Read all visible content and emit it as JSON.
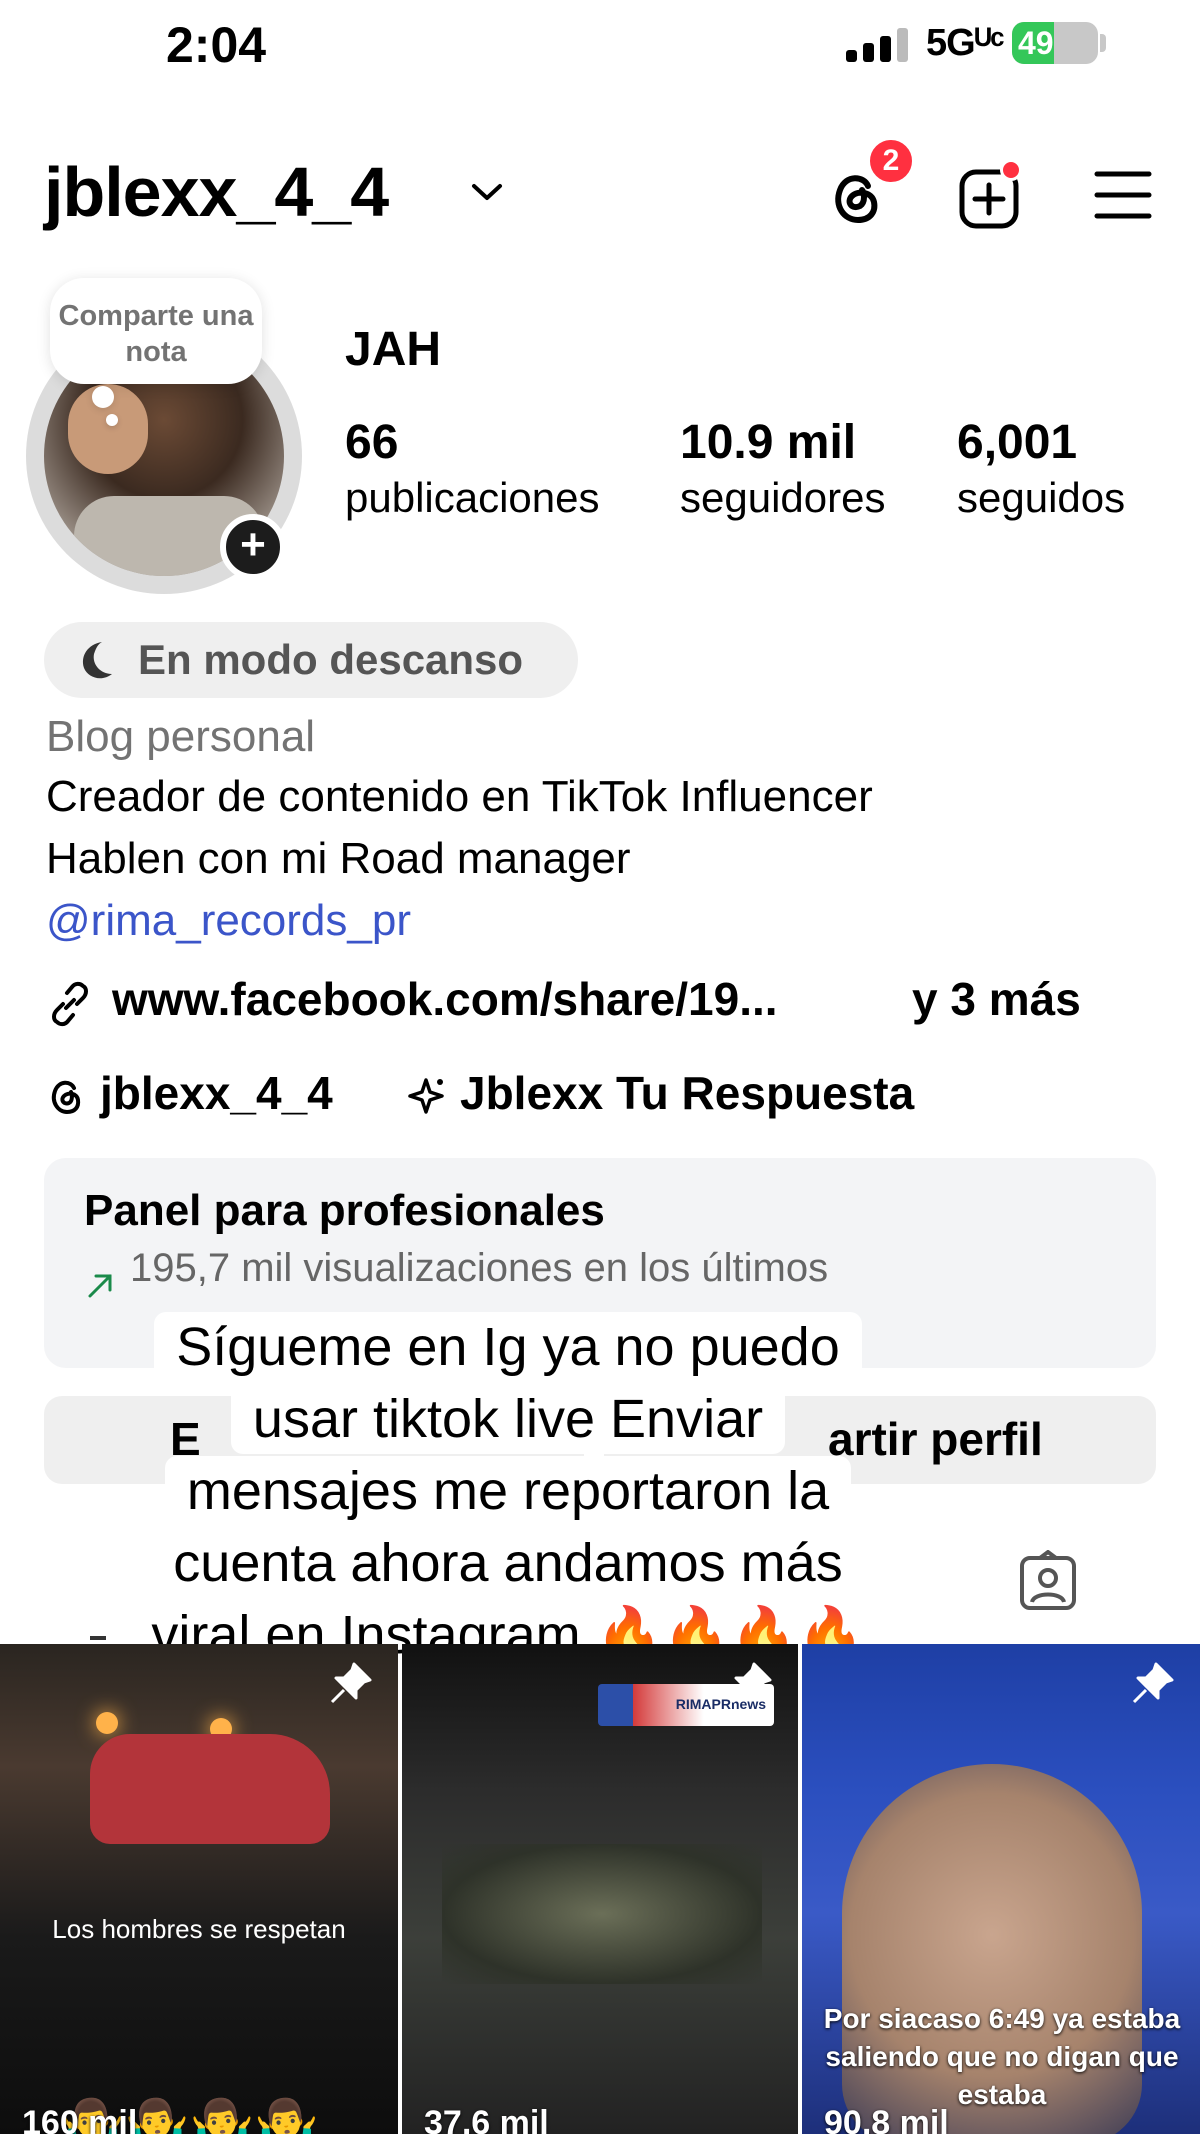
{
  "status_bar": {
    "time": "2:04",
    "network": "5Gᵁᶜ",
    "battery": "49",
    "battery_level_percent": 49,
    "battery_color": "#34c759"
  },
  "header": {
    "username": "jblexx_4_4",
    "threads_badge": "2",
    "icons": [
      "threads-icon",
      "create-icon",
      "menu-icon"
    ],
    "badge_color": "#ff3040"
  },
  "profile": {
    "note_bubble": "Comparte una nota",
    "display_name": "JAH",
    "stats": [
      {
        "value": "66",
        "label": "publicaciones"
      },
      {
        "value": "10.9 mil",
        "label": "seguidores"
      },
      {
        "value": "6,001",
        "label": "seguidos"
      }
    ]
  },
  "rest_mode": {
    "label": "En modo descanso"
  },
  "bio": {
    "category": "Blog personal",
    "lines": [
      "Creador de contenido en TikTok Influencer",
      "Hablen con mi Road manager"
    ],
    "mention": "@rima_records_pr",
    "mention_color": "#3b55c9"
  },
  "link": {
    "url": "www.facebook.com/share/19...",
    "more": "y 3 más"
  },
  "threads_row": {
    "handle": "jblexx_4_4",
    "ai_name": "Jblexx Tu Respuesta"
  },
  "pro_panel": {
    "title": "Panel para profesionales",
    "subtitle": "195,7 mil visualizaciones en los últimos"
  },
  "buttons": {
    "left_partial": "E",
    "right_partial": "artir perfil"
  },
  "caption_overlay": {
    "lines": [
      "Sígueme en Ig ya no puedo",
      "usar tiktok live Enviar",
      "mensajes me reportaron la",
      "cuenta ahora andamos más",
      "viral en Instagram 🔥🔥🔥🔥"
    ]
  },
  "grid": {
    "tiles": [
      {
        "caption": "Los hombres se respetan",
        "views": "160 mil",
        "pinned": true
      },
      {
        "caption": "",
        "views": "37,6 mil",
        "logo": "RIMAPRnews",
        "pinned": true
      },
      {
        "caption": "Por siacaso 6:49 ya estaba saliendo que no digan que estaba",
        "views": "90,8 mil",
        "pinned": true
      }
    ]
  }
}
